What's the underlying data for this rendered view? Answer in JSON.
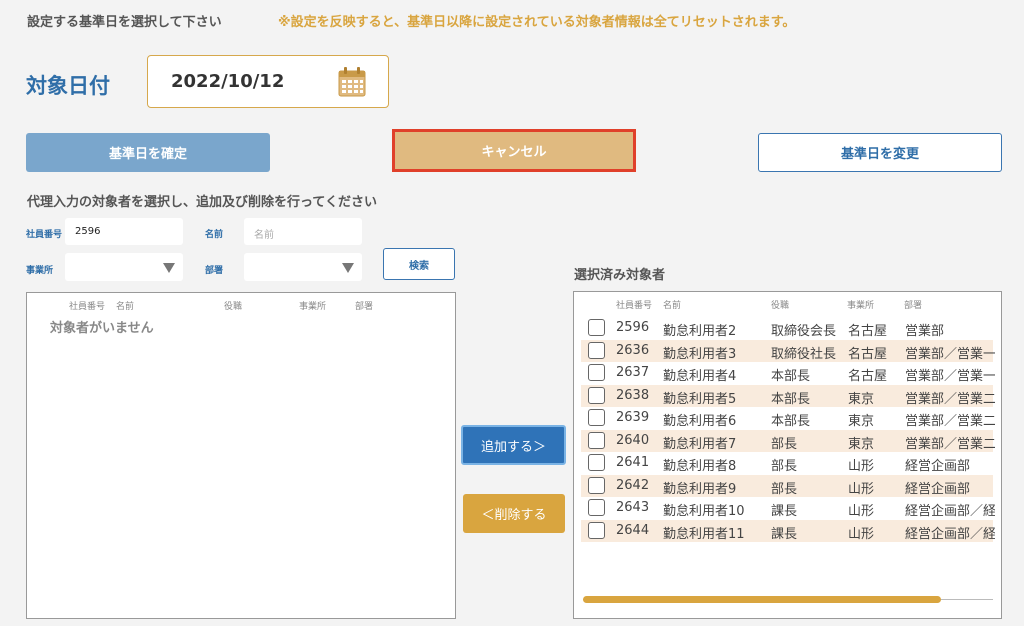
{
  "header": {
    "instruction": "設定する基準日を選択して下さい",
    "warning": "※設定を反映すると、基準日以降に設定されている対象者情報は全てリセットされます。"
  },
  "date": {
    "label": "対象日付",
    "value": "2022/10/12",
    "icon": "calendar-icon"
  },
  "buttons": {
    "confirm": "基準日を確定",
    "cancel": "キャンセル",
    "change": "基準日を変更",
    "search": "検索",
    "add": "追加する＞",
    "delete": "＜削除する"
  },
  "search": {
    "instruction": "代理入力の対象者を選択し、追加及び削除を行ってください",
    "employee_no_label": "社員番号",
    "employee_no_value": "2596",
    "name_label": "名前",
    "name_placeholder": "名前",
    "office_label": "事業所",
    "dept_label": "部署"
  },
  "left_table": {
    "headers": [
      "社員番号",
      "名前",
      "役職",
      "事業所",
      "部署"
    ],
    "empty_message": "対象者がいません"
  },
  "right_table": {
    "title": "選択済み対象者",
    "headers": [
      "社員番号",
      "名前",
      "役職",
      "事業所",
      "部署"
    ],
    "rows": [
      [
        "2596",
        "勤怠利用者2",
        "取締役会長",
        "名古屋",
        "営業部"
      ],
      [
        "2636",
        "勤怠利用者3",
        "取締役社長",
        "名古屋",
        "営業部／営業一"
      ],
      [
        "2637",
        "勤怠利用者4",
        "本部長",
        "名古屋",
        "営業部／営業一"
      ],
      [
        "2638",
        "勤怠利用者5",
        "本部長",
        "東京",
        "営業部／営業二"
      ],
      [
        "2639",
        "勤怠利用者6",
        "本部長",
        "東京",
        "営業部／営業二"
      ],
      [
        "2640",
        "勤怠利用者7",
        "部長",
        "東京",
        "営業部／営業二"
      ],
      [
        "2641",
        "勤怠利用者8",
        "部長",
        "山形",
        "経営企画部"
      ],
      [
        "2642",
        "勤怠利用者9",
        "部長",
        "山形",
        "経営企画部"
      ],
      [
        "2643",
        "勤怠利用者10",
        "課長",
        "山形",
        "経営企画部／経"
      ],
      [
        "2644",
        "勤怠利用者11",
        "課長",
        "山形",
        "経営企画部／経"
      ]
    ]
  },
  "colors": {
    "accent_blue": "#2f6ea8",
    "accent_gold": "#d9a53f",
    "cancel_highlight": "#e0402a"
  }
}
